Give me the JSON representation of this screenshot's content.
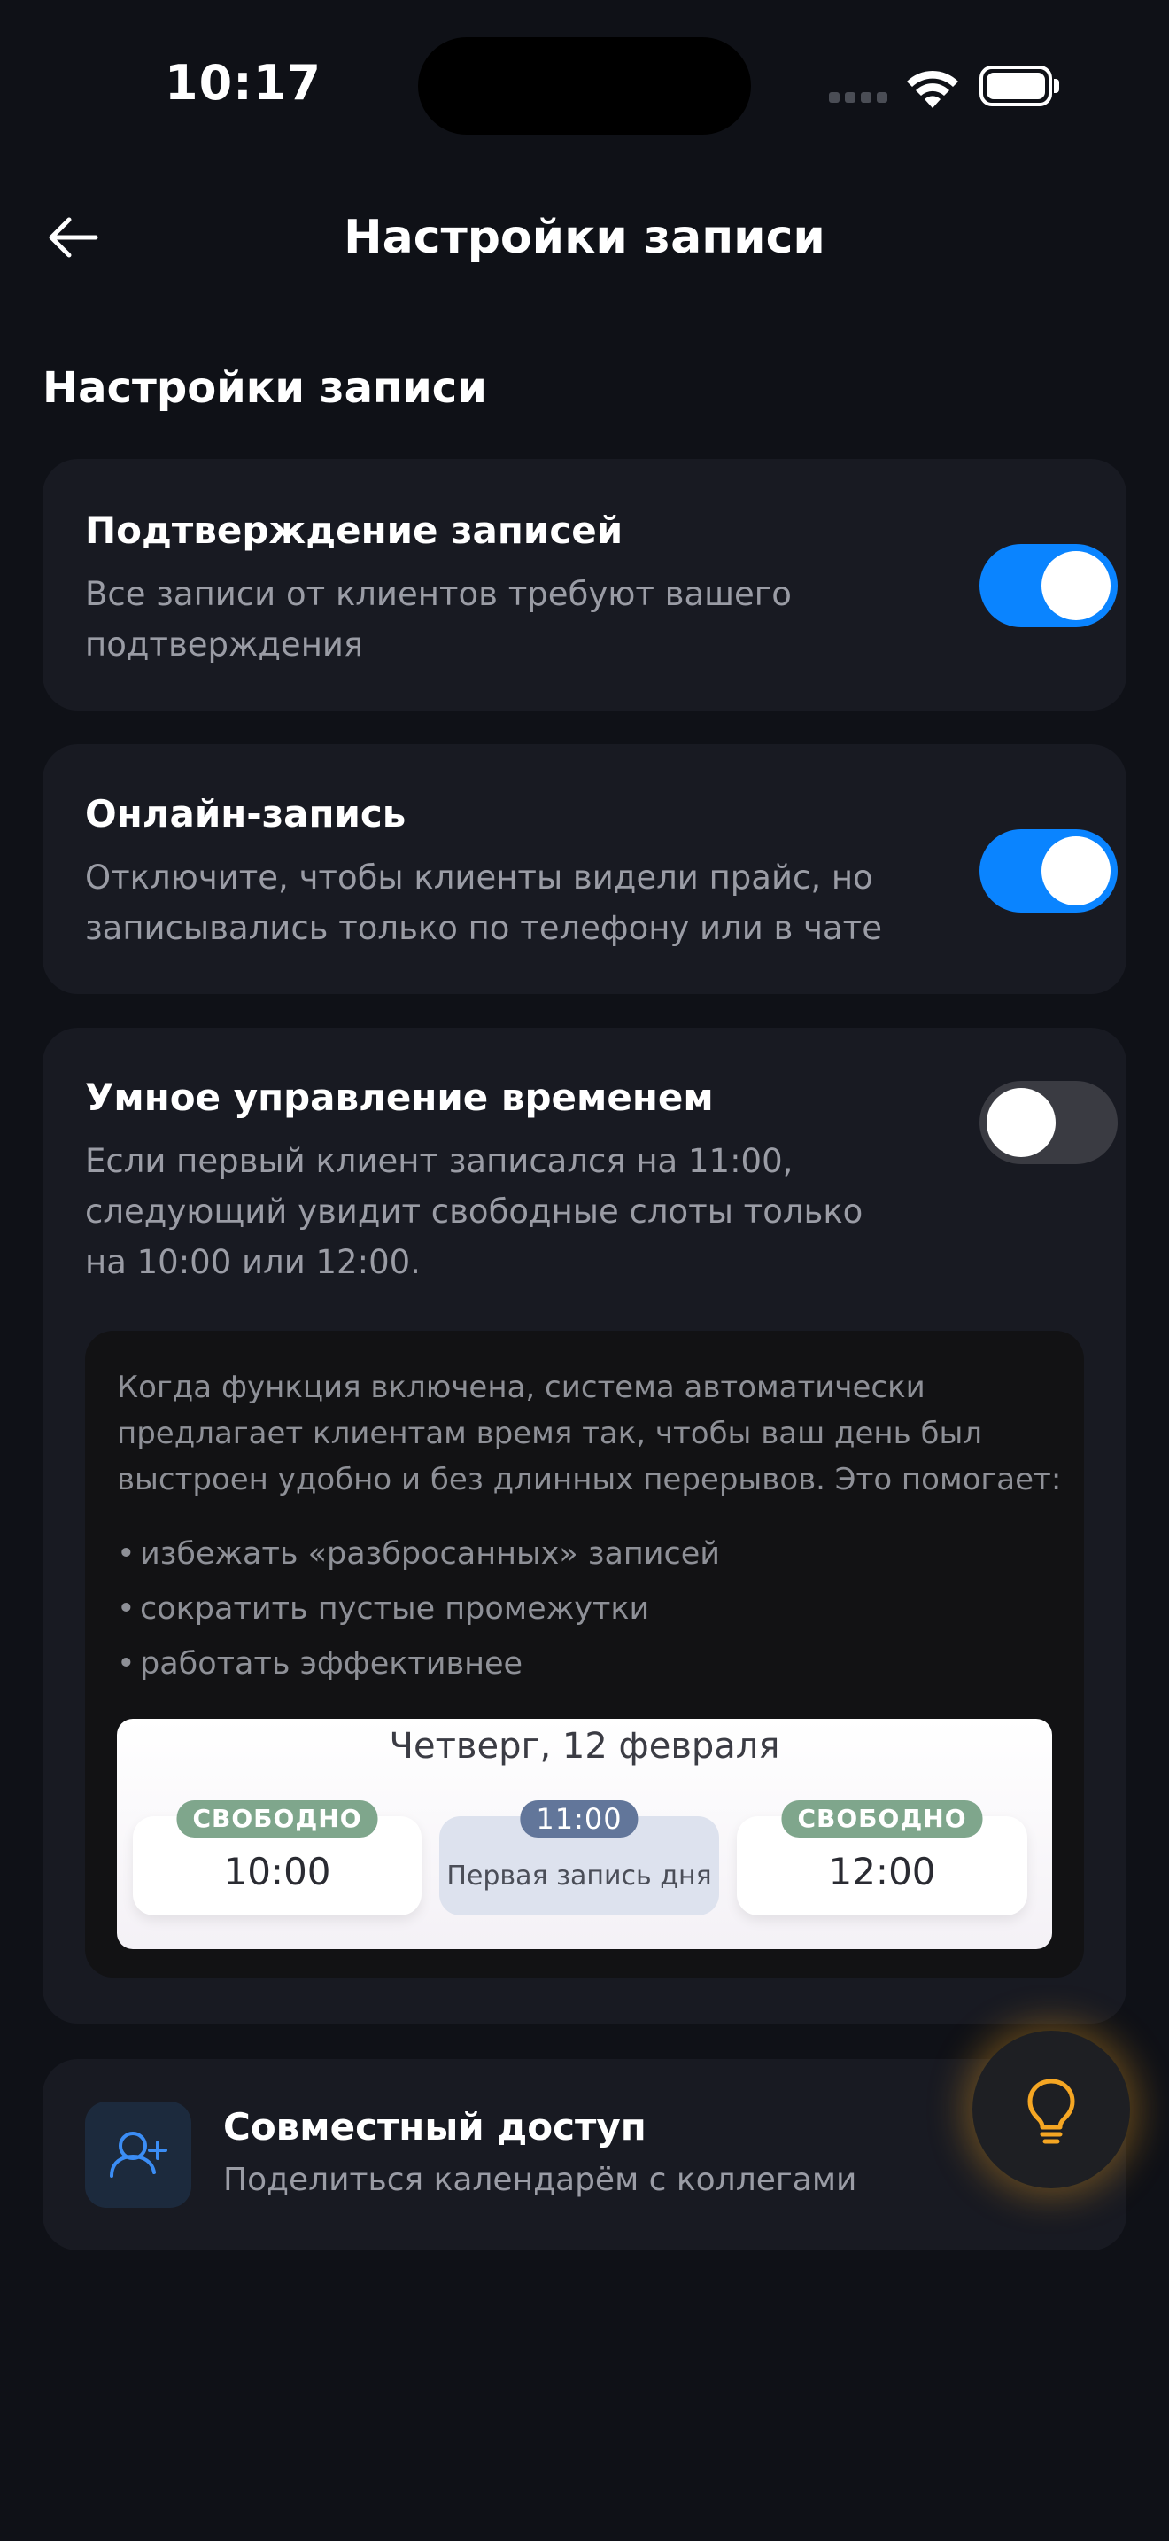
{
  "status_bar": {
    "time": "10:17"
  },
  "nav": {
    "title": "Настройки записи"
  },
  "section_title": "Настройки записи",
  "settings": [
    {
      "title": "Подтверждение записей",
      "description": "Все записи от клиентов требуют вашего подтверждения",
      "enabled": true
    },
    {
      "title": "Онлайн-запись",
      "description": "Отключите, чтобы клиенты видели прайс, но записывались только по телефону или в чате",
      "enabled": true
    },
    {
      "title": "Умное управление временем",
      "description": "Если первый клиент записался на 11:00, следующий увидит свободные слоты только на 10:00 или 12:00.",
      "enabled": false
    }
  ],
  "info": {
    "text": "Когда функция включена, система автоматически предлагает клиентам время так, чтобы ваш день был выстроен удобно и без длинных перерывов. Это помогает:",
    "bullets": [
      "избежать «разбросанных» записей",
      "сократить пустые промежутки",
      "работать эффективнее"
    ],
    "bullet_marker": "•"
  },
  "preview": {
    "date": "Четверг, 12 февраля",
    "slots": [
      {
        "badge": "СВОБОДНО",
        "label": "10:00"
      },
      {
        "badge": "11:00",
        "label": "Первая запись дня"
      },
      {
        "badge": "СВОБОДНО",
        "label": "12:00"
      }
    ]
  },
  "share": {
    "title": "Совместный доступ",
    "subtitle": "Поделиться календарём с коллегами",
    "icon": "add-user-icon"
  },
  "fab": {
    "icon": "lightbulb-icon"
  },
  "colors": {
    "background": "#0f1117",
    "card": "#181a22",
    "toggle_on": "#0a84ff",
    "toggle_off": "#3a3b42",
    "accent_glow": "#f5a623",
    "free_badge": "#7fa68c",
    "busy_badge": "#62769a"
  }
}
